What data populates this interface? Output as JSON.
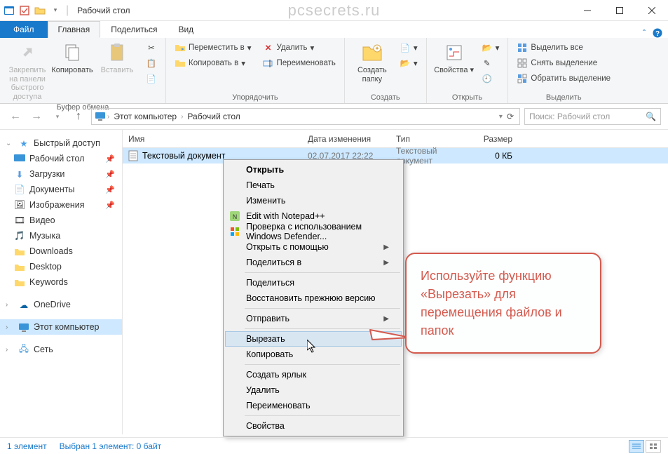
{
  "titlebar": {
    "title": "Рабочий стол",
    "watermark": "pcsecrets.ru"
  },
  "ribbon": {
    "file": "Файл",
    "tabs": [
      "Главная",
      "Поделиться",
      "Вид"
    ],
    "active_tab": 0,
    "groups": {
      "clipboard": {
        "label": "Буфер обмена",
        "pin": "Закрепить на панели быстрого доступа",
        "copy": "Копировать",
        "paste": "Вставить"
      },
      "organize": {
        "label": "Упорядочить",
        "move_to": "Переместить в",
        "delete": "Удалить",
        "copy_to": "Копировать в",
        "rename": "Переименовать"
      },
      "new": {
        "label": "Создать",
        "new_folder": "Создать папку"
      },
      "open": {
        "label": "Открыть",
        "properties": "Свойства"
      },
      "select": {
        "label": "Выделить",
        "select_all": "Выделить все",
        "select_none": "Снять выделение",
        "invert": "Обратить выделение"
      }
    }
  },
  "breadcrumbs": [
    "Этот компьютер",
    "Рабочий стол"
  ],
  "search_placeholder": "Поиск: Рабочий стол",
  "nav": {
    "quick_access": "Быстрый доступ",
    "items": [
      "Рабочий стол",
      "Загрузки",
      "Документы",
      "Изображения",
      "Видео",
      "Музыка",
      "Downloads",
      "Desktop",
      "Keywords"
    ],
    "onedrive": "OneDrive",
    "this_pc": "Этот компьютер",
    "network": "Сеть"
  },
  "columns": {
    "name": "Имя",
    "date": "Дата изменения",
    "type": "Тип",
    "size": "Размер"
  },
  "file": {
    "name": "Текстовый документ",
    "date": "02.07.2017 22:22",
    "type": "Текстовый документ",
    "size": "0 КБ"
  },
  "context_menu": {
    "open": "Открыть",
    "print": "Печать",
    "edit": "Изменить",
    "edit_npp": "Edit with Notepad++",
    "defender": "Проверка с использованием Windows Defender...",
    "open_with": "Открыть с помощью",
    "share_in": "Поделиться в",
    "share": "Поделиться",
    "restore": "Восстановить прежнюю версию",
    "send_to": "Отправить",
    "cut": "Вырезать",
    "copy": "Копировать",
    "shortcut": "Создать ярлык",
    "delete": "Удалить",
    "rename": "Переименовать",
    "properties": "Свойства"
  },
  "callout_text": "Используйте функцию «Вырезать» для перемещения файлов и папок",
  "status": {
    "count": "1 элемент",
    "selected": "Выбран 1 элемент: 0 байт"
  }
}
